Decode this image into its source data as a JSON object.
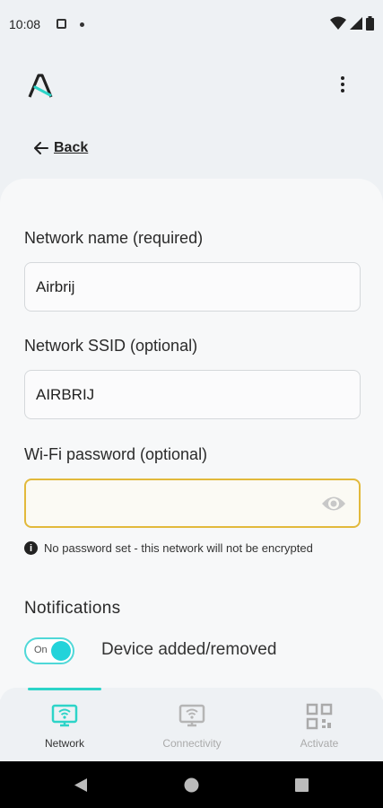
{
  "status_bar": {
    "time": "10:08"
  },
  "header": {
    "logo_icon": "airbrij-logo-icon",
    "menu_icon": "more-vertical-icon"
  },
  "back": {
    "label": "Back"
  },
  "form": {
    "network_name": {
      "label": "Network name (required)",
      "value": "Airbrij"
    },
    "network_ssid": {
      "label": "Network SSID (optional)",
      "value": "AIRBRIJ"
    },
    "wifi_password": {
      "label": "Wi-Fi password (optional)",
      "value": "",
      "hint": "No password set - this network will not be encrypted"
    }
  },
  "notifications": {
    "title": "Notifications",
    "toggle_state": "On",
    "toggle_label": "Device added/removed"
  },
  "bottom_nav": {
    "items": [
      {
        "label": "Network",
        "icon": "network-monitor-icon",
        "active": true
      },
      {
        "label": "Connectivity",
        "icon": "connectivity-monitor-icon",
        "active": false
      },
      {
        "label": "Activate",
        "icon": "qr-code-icon",
        "active": false
      }
    ]
  },
  "colors": {
    "accent": "#2dd4c8",
    "focus_border": "#e2b93b",
    "background": "#eef1f4",
    "card": "#f7f8f9"
  }
}
